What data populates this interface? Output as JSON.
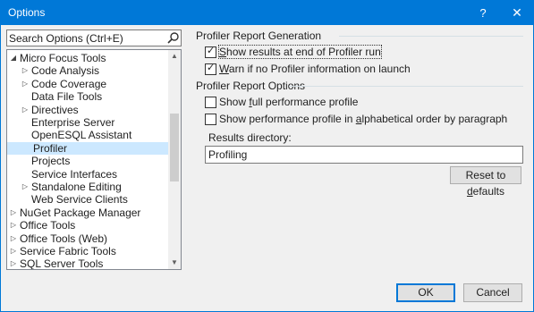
{
  "window": {
    "title": "Options",
    "help_label": "?",
    "close_label": "✕"
  },
  "search": {
    "placeholder": "Search Options (Ctrl+E)"
  },
  "tree": {
    "items": [
      {
        "label": "Micro Focus Tools",
        "arrow": "◢",
        "level": 0
      },
      {
        "label": "Code Analysis",
        "arrow": "▷",
        "level": 1
      },
      {
        "label": "Code Coverage",
        "arrow": "▷",
        "level": 1
      },
      {
        "label": "Data File Tools",
        "arrow": "",
        "level": 1
      },
      {
        "label": "Directives",
        "arrow": "▷",
        "level": 1
      },
      {
        "label": "Enterprise Server",
        "arrow": "",
        "level": 1
      },
      {
        "label": "OpenESQL Assistant",
        "arrow": "",
        "level": 1
      },
      {
        "label": "Profiler",
        "arrow": "",
        "level": 1,
        "selected": true
      },
      {
        "label": "Projects",
        "arrow": "",
        "level": 1
      },
      {
        "label": "Service Interfaces",
        "arrow": "",
        "level": 1
      },
      {
        "label": "Standalone Editing",
        "arrow": "▷",
        "level": 1
      },
      {
        "label": "Web Service Clients",
        "arrow": "",
        "level": 1
      },
      {
        "label": "NuGet Package Manager",
        "arrow": "▷",
        "level": 0
      },
      {
        "label": "Office Tools",
        "arrow": "▷",
        "level": 0
      },
      {
        "label": "Office Tools (Web)",
        "arrow": "▷",
        "level": 0
      },
      {
        "label": "Service Fabric Tools",
        "arrow": "▷",
        "level": 0
      },
      {
        "label": "SQL Server Tools",
        "arrow": "▷",
        "level": 0
      }
    ],
    "scroll_up": "▲",
    "scroll_down": "▼"
  },
  "report_generation": {
    "heading": "Profiler Report Generation",
    "options": [
      {
        "pre": "",
        "key": "S",
        "post": "how results at end of Profiler run",
        "checked": true,
        "focused": true
      },
      {
        "pre": "",
        "key": "W",
        "post": "arn if no Profiler information on launch",
        "checked": true,
        "focused": false
      }
    ]
  },
  "report_options": {
    "heading": "Profiler Report Options",
    "options": [
      {
        "pre": "Show ",
        "key": "f",
        "post": "ull performance profile",
        "checked": false
      },
      {
        "pre": "Show performance profile in ",
        "key": "a",
        "post": "lphabetical order by paragraph",
        "checked": false
      }
    ],
    "results_label": "Results directory:",
    "results_value": "Profiling"
  },
  "buttons": {
    "reset_pre": "Reset to ",
    "reset_key": "d",
    "reset_post": "efaults",
    "ok": "OK",
    "cancel": "Cancel"
  }
}
